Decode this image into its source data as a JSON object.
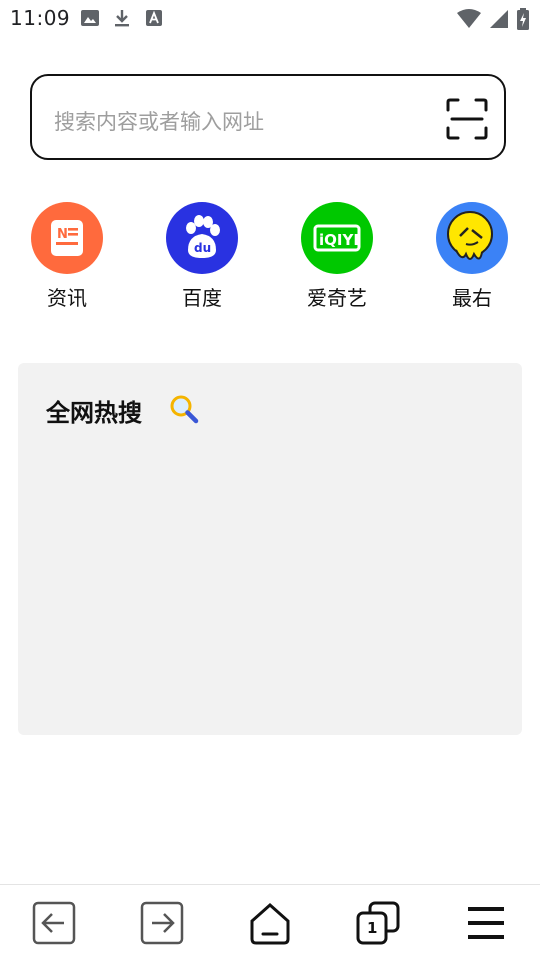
{
  "status_bar": {
    "time": "11:09",
    "left_icons": [
      "image-icon",
      "download-icon",
      "font-icon"
    ],
    "right_icons": [
      "wifi-icon",
      "signal-icon",
      "battery-icon"
    ]
  },
  "search": {
    "placeholder": "搜索内容或者输入网址",
    "scan_icon": "scan-icon"
  },
  "shortcuts": [
    {
      "label": "资讯",
      "icon": "news-icon",
      "color": "#ff6a3d"
    },
    {
      "label": "百度",
      "icon": "baidu-paw-icon",
      "color": "#2932e1"
    },
    {
      "label": "爱奇艺",
      "icon": "iqiyi-icon",
      "color": "#00c800"
    },
    {
      "label": "最右",
      "icon": "zuiyou-icon",
      "color": "#3b82f6"
    }
  ],
  "hot_search": {
    "title": "全网热搜",
    "icon": "magnifier-emoji-icon"
  },
  "bottom_nav": {
    "items": [
      "back-icon",
      "forward-icon",
      "home-icon",
      "tabs-icon",
      "menu-icon"
    ],
    "tab_count": "1"
  }
}
